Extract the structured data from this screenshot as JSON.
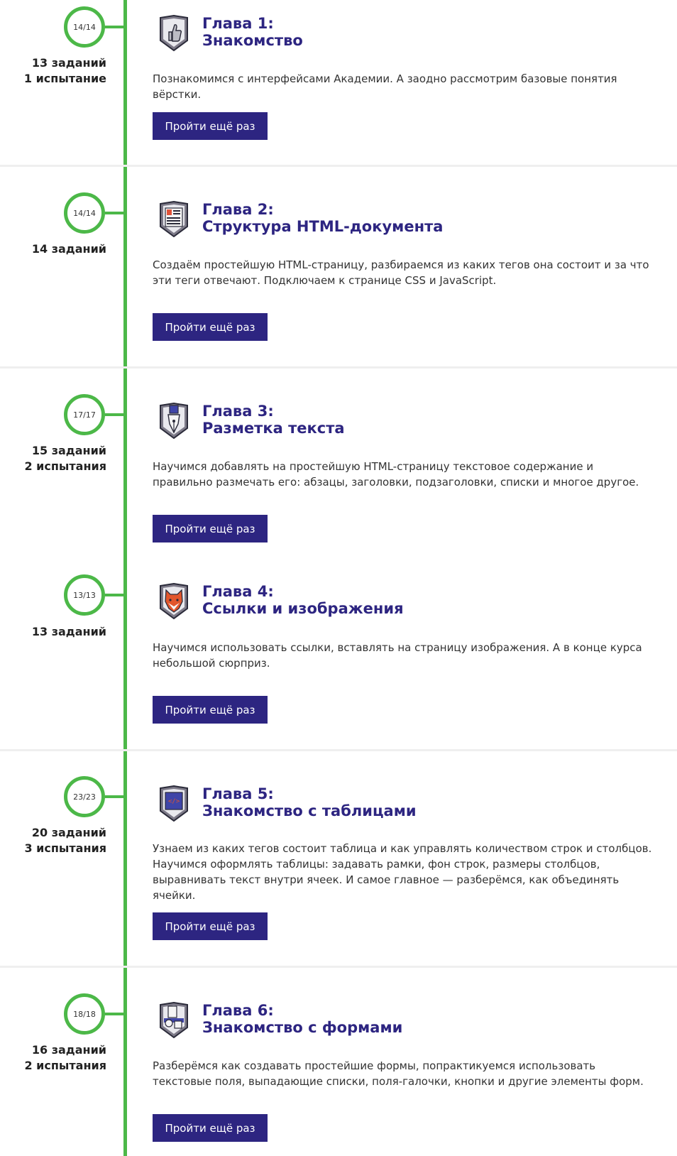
{
  "colors": {
    "accent_green": "#4cb848",
    "brand_purple": "#2d2581",
    "divider": "#efefef"
  },
  "chapters": [
    {
      "progress": "14/14",
      "stats": [
        "13 заданий",
        "1 испытание"
      ],
      "badge_icon": "thumbs-up-icon",
      "title_line1": "Глава 1:",
      "title_line2": "Знакомство",
      "description": "Познакомимся с интерфейсами Академии. А заодно рассмотрим базовые понятия вёрстки.",
      "button_label": "Пройти ещё раз"
    },
    {
      "progress": "14/14",
      "stats": [
        "14 заданий"
      ],
      "badge_icon": "document-icon",
      "title_line1": "Глава 2:",
      "title_line2": "Структура HTML-документа",
      "description": "Создаём простейшую HTML-страницу, разбираемся из каких тегов она состоит и за что эти теги отвечают. Подключаем к странице CSS и JavaScript.",
      "button_label": "Пройти ещё раз"
    },
    {
      "progress": "17/17",
      "stats": [
        "15 заданий",
        "2 испытания"
      ],
      "badge_icon": "fountain-pen-icon",
      "title_line1": "Глава 3:",
      "title_line2": "Разметка текста",
      "description": "Научимся добавлять на простейшую HTML-страницу текстовое содержание и правильно размечать его: абзацы, заголовки, подзаголовки, списки и многое другое.",
      "button_label": "Пройти ещё раз"
    },
    {
      "progress": "13/13",
      "stats": [
        "13 заданий"
      ],
      "badge_icon": "fox-icon",
      "title_line1": "Глава 4:",
      "title_line2": "Ссылки и изображения",
      "description": "Научимся использовать ссылки, вставлять на страницу изображения. А в конце курса небольшой сюрприз.",
      "button_label": "Пройти ещё раз"
    },
    {
      "progress": "23/23",
      "stats": [
        "20 заданий",
        "3 испытания"
      ],
      "badge_icon": "code-board-icon",
      "title_line1": "Глава 5:",
      "title_line2": "Знакомство с таблицами",
      "description": "Узнаем из каких тегов состоит таблица и как управлять количеством строк и столбцов. Научимся оформлять таблицы: задавать рамки, фон строк, размеры столбцов, выравнивать текст внутри ячеек. И самое главное — разберёмся, как объединять ячейки.",
      "button_label": "Пройти ещё раз"
    },
    {
      "progress": "18/18",
      "stats": [
        "16 заданий",
        "2 испытания"
      ],
      "badge_icon": "forms-icon",
      "title_line1": "Глава 6:",
      "title_line2": "Знакомство с формами",
      "description": "Разберёмся как создавать простейшие формы, попрактикуемся использовать текстовые поля, выпадающие списки, поля-галочки, кнопки и другие элементы форм.",
      "button_label": "Пройти ещё раз"
    }
  ]
}
